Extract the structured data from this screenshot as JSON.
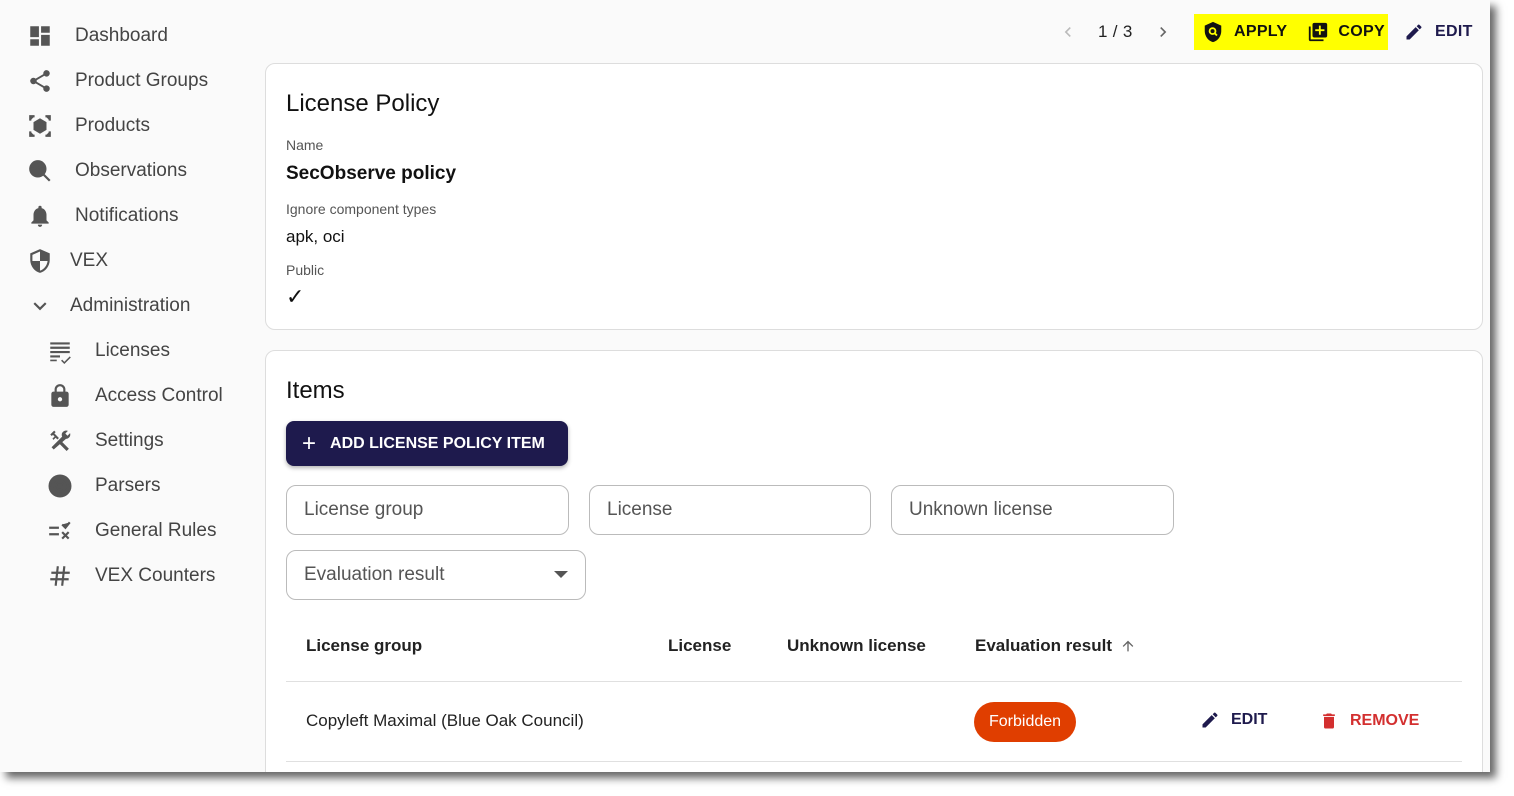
{
  "sidebar": {
    "items": [
      {
        "label": "Dashboard",
        "icon": "dashboard-icon"
      },
      {
        "label": "Product Groups",
        "icon": "share-icon"
      },
      {
        "label": "Products",
        "icon": "cube-scan-icon"
      },
      {
        "label": "Observations",
        "icon": "search-pulse-icon"
      },
      {
        "label": "Notifications",
        "icon": "bell-icon"
      },
      {
        "label": "VEX",
        "icon": "shield-icon"
      },
      {
        "label": "Administration",
        "icon": "chevron-down-icon"
      },
      {
        "label": "Licenses",
        "icon": "list-check-icon"
      },
      {
        "label": "Access Control",
        "icon": "lock-icon"
      },
      {
        "label": "Settings",
        "icon": "tools-icon"
      },
      {
        "label": "Parsers",
        "icon": "target-icon"
      },
      {
        "label": "General Rules",
        "icon": "rule-icon"
      },
      {
        "label": "VEX Counters",
        "icon": "hash-icon"
      }
    ]
  },
  "toolbar": {
    "pager": "1 / 3",
    "apply": "APPLY",
    "copy": "COPY",
    "edit": "EDIT",
    "highlight": "#ffff00"
  },
  "policy": {
    "title": "License Policy",
    "name_label": "Name",
    "name": "SecObserve policy",
    "ignore_label": "Ignore component types",
    "ignore": "apk, oci",
    "public_label": "Public",
    "public_mark": "✓"
  },
  "items": {
    "title": "Items",
    "add_button": "ADD LICENSE POLICY ITEM",
    "filters": {
      "license_group": "License group",
      "license": "License",
      "unknown_license": "Unknown license",
      "evaluation_result": "Evaluation result"
    },
    "columns": [
      "License group",
      "License",
      "Unknown license",
      "Evaluation result"
    ],
    "rows": [
      {
        "license_group": "Copyleft Maximal (Blue Oak Council)",
        "license": "",
        "unknown_license": "",
        "evaluation_result": "Forbidden",
        "edit": "EDIT",
        "remove": "REMOVE"
      }
    ]
  },
  "colors": {
    "primary": "#1e1a4d",
    "forbidden": "#e03e00",
    "remove": "#d32f2f"
  }
}
